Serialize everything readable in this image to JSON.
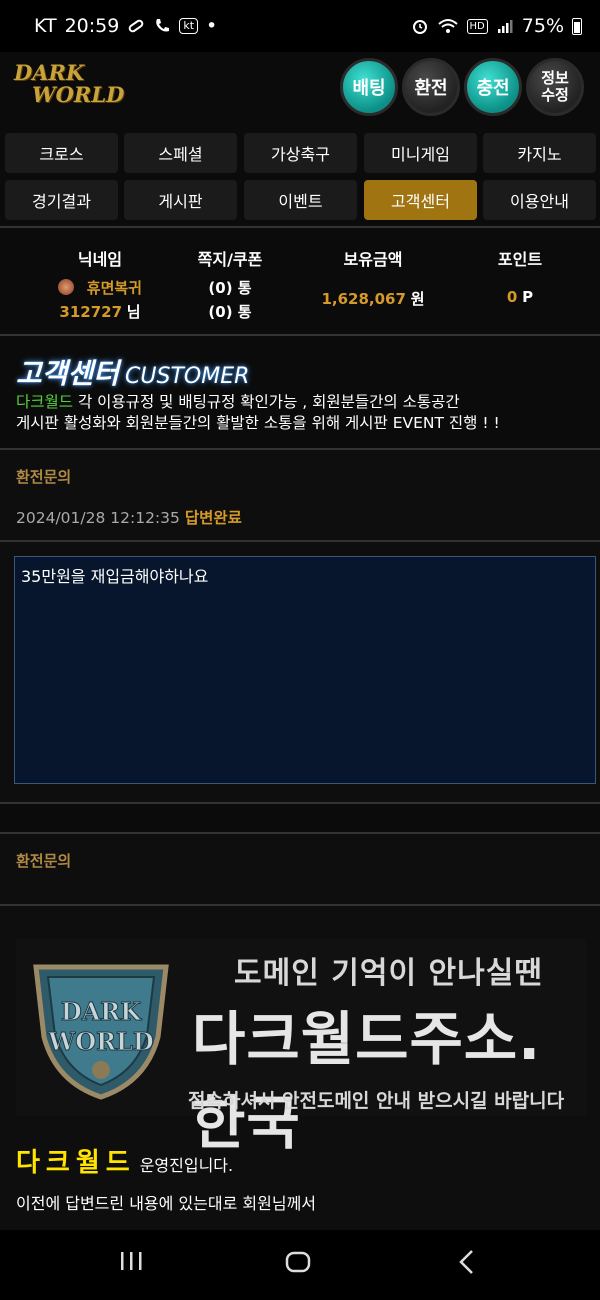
{
  "status_bar": {
    "carrier": "KT",
    "time": "20:59",
    "carrier_badge": "kt",
    "dot": "•",
    "battery": "75%"
  },
  "header": {
    "logo_line1": "DARK",
    "logo_line2": "WORLD",
    "buttons": [
      "배팅",
      "환전",
      "충전",
      "정보\n수정"
    ]
  },
  "nav": {
    "row1": [
      "크로스",
      "스페셜",
      "가상축구",
      "미니게임",
      "카지노"
    ],
    "row2": [
      "경기결과",
      "게시판",
      "이벤트",
      "고객센터",
      "이용안내"
    ],
    "active": "고객센터"
  },
  "user_info": {
    "nickname_label": "닉네임",
    "nickname_status": "휴면복귀",
    "nickname_id": "312727",
    "nickname_suffix": "님",
    "messages_label": "쪽지/쿠폰",
    "messages_value": "(0) 통",
    "coupons_value": "(0) 통",
    "balance_label": "보유금액",
    "balance_value": "1,628,067",
    "balance_unit": "원",
    "points_label": "포인트",
    "points_value": "0",
    "points_unit": "P"
  },
  "page": {
    "title_ko": "고객센터",
    "title_en": "CUSTOMER",
    "desc_brand": "다크월드",
    "desc_line1_rest": " 각 이용규정 및 배팅규정 확인가능 , 회원분들간의 소통공간",
    "desc_line2": "게시판 활성화와 회원분들간의 활발한 소통을 위해 게시판 EVENT 진행 ! !"
  },
  "question": {
    "category": "환전문의",
    "datetime": "2024/01/28 12:12:35",
    "status": "답변완료",
    "content": "35만원을 재입금해야하나요"
  },
  "answer": {
    "category": "환전문의",
    "banner_shield_line1": "DARK",
    "banner_shield_line2": "WORLD",
    "banner_line1": "도메인 기억이 안나실땐",
    "banner_line2": "다크월드주소.한국",
    "banner_line3": "접속하셔서 안전도메인 안내 받으시길 바랍니다",
    "signature_brand": "다크월드",
    "signature_rest": "운영진입니다.",
    "body_line1": "이전에 답변드린 내용에 있는대로 회원님께서"
  },
  "colors": {
    "accent_gold": "#d49a2a",
    "active_tab": "#a17412",
    "teal_button": "#14b3a6",
    "brand_green": "#55d23b",
    "signature_yellow": "#ffe400"
  }
}
